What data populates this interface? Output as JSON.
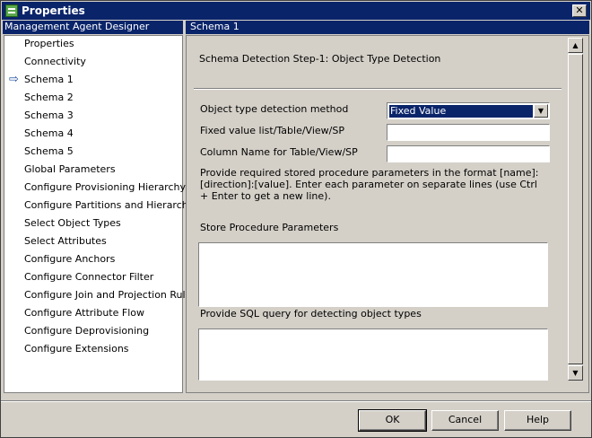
{
  "window": {
    "title": "Properties",
    "close_glyph": "✕"
  },
  "left_header": "Management Agent Designer",
  "nav": {
    "active_marker": "⇨",
    "items": [
      "Properties",
      "Connectivity",
      "Schema 1",
      "Schema 2",
      "Schema 3",
      "Schema 4",
      "Schema 5",
      "Global Parameters",
      "Configure Provisioning Hierarchy",
      "Configure Partitions and Hierarchies",
      "Select Object Types",
      "Select Attributes",
      "Configure Anchors",
      "Configure Connector Filter",
      "Configure Join and Projection Rules",
      "Configure Attribute Flow",
      "Configure Deprovisioning",
      "Configure Extensions"
    ],
    "active_item": "Schema 1"
  },
  "right_header": "Schema 1",
  "form": {
    "step_title": "Schema Detection Step-1: Object Type Detection",
    "detection_method_label": "Object type detection method",
    "detection_method_value": "Fixed Value",
    "fixed_value_label": "Fixed value list/Table/View/SP",
    "fixed_value_value": "",
    "column_name_label": "Column Name for Table/View/SP",
    "column_name_value": "",
    "instructions": "Provide required stored procedure parameters in the format [name]:[direction]:[value]. Enter each parameter on separate lines (use Ctrl + Enter to get a new line).",
    "sp_params_label": "Store Procedure Parameters",
    "sp_params_value": "",
    "sql_query_label": "Provide SQL query for detecting object types",
    "sql_query_value": ""
  },
  "buttons": {
    "ok": "OK",
    "cancel": "Cancel",
    "help": "Help"
  },
  "icons": {
    "scroll_up": "▲",
    "scroll_down": "▼",
    "dropdown": "▼"
  }
}
